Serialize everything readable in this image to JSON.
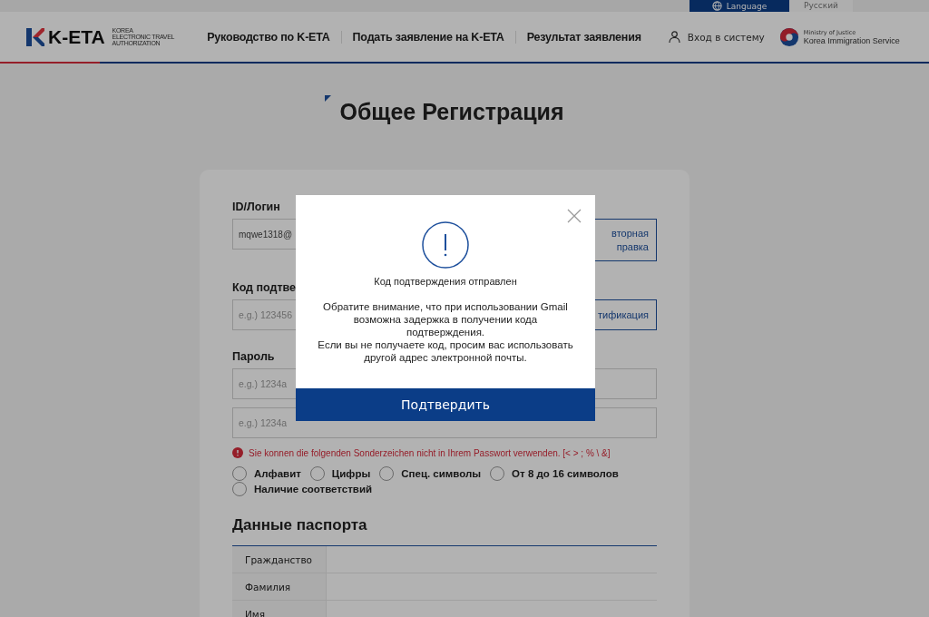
{
  "top_bar": {
    "language_button": "Language",
    "current_language": "Русский"
  },
  "header": {
    "logo": {
      "text": "K-ETA",
      "subtitle": [
        "KOREA",
        "ELECTRONIC TRAVEL",
        "AUTHORIZATION"
      ]
    },
    "nav": [
      "Руководство по K-ETA",
      "Подать заявление на K-ETA",
      "Результат заявления"
    ],
    "login": "Вход в систему",
    "ministry": {
      "line1": "Ministry of Justice",
      "line2": "Korea Immigration Service"
    }
  },
  "page_title": "Общее Регистрация",
  "form": {
    "id_label": "ID/Логин",
    "id_value": "mqwe1318@",
    "resend_button": [
      "вторная",
      "правка"
    ],
    "code_label": "Код подтве",
    "code_placeholder": "e.g.) 123456",
    "verify_button": "тификация",
    "password_label": "Пароль",
    "password_placeholder": "e.g.) 1234a",
    "confirm_placeholder": "e.g.) 1234a",
    "error": "Sie konnen die folgenden Sonderzeichen nicht in Ihrem Passwort verwenden. [< > ; % \\ &]",
    "checks": [
      {
        "label": "Алфавит",
        "checked": false
      },
      {
        "label": "Цифры",
        "checked": false
      },
      {
        "label": "Спец. символы",
        "checked": false
      },
      {
        "label": "От 8 до 16 символов",
        "checked": false
      },
      {
        "label": "Наличие соответствий",
        "checked": false
      }
    ]
  },
  "passport": {
    "heading": "Данные паспорта",
    "rows": [
      "Гражданство",
      "Фамилия",
      "Имя"
    ]
  },
  "dialog": {
    "title": "Код подтверждения отправлен",
    "message": [
      "Обратите внимание, что при использовании Gmail возможна задержка в получении кода подтверждения.",
      "Если вы не получаете код, просим вас использовать другой адрес электронной почты."
    ],
    "confirm_button": "Подтвердить"
  }
}
